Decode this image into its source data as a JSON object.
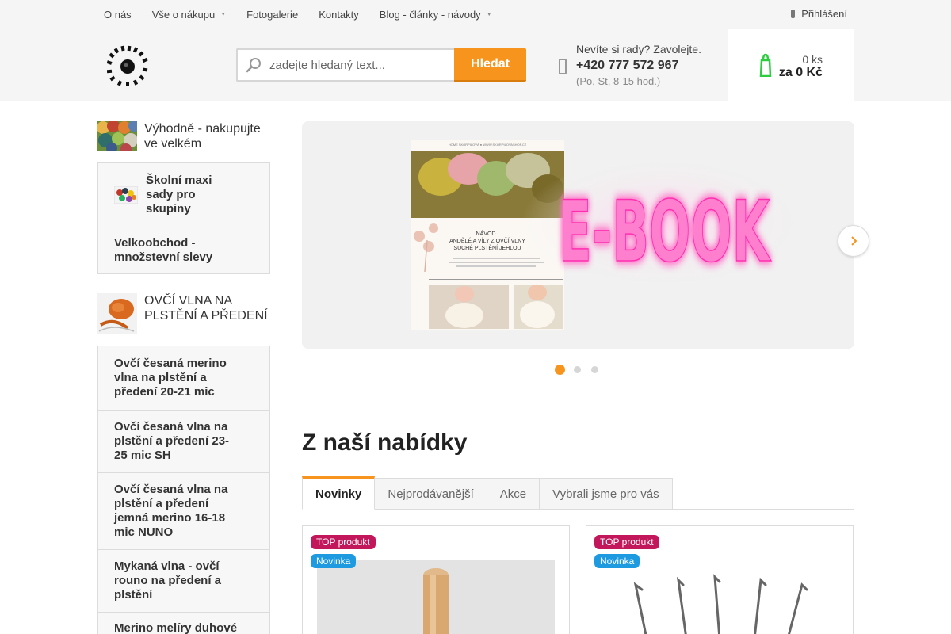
{
  "topnav": {
    "items": [
      {
        "label": "O nás",
        "has_dropdown": false
      },
      {
        "label": "Vše o nákupu",
        "has_dropdown": true
      },
      {
        "label": "Fotogalerie",
        "has_dropdown": false
      },
      {
        "label": "Kontakty",
        "has_dropdown": false
      },
      {
        "label": "Blog - články - návody",
        "has_dropdown": true
      }
    ],
    "login_label": "Přihlášení"
  },
  "header": {
    "search_placeholder": "zadejte hledaný text...",
    "search_button": "Hledat",
    "contact_question": "Nevíte si rady? Zavolejte.",
    "contact_phone": "+420 777 572 967",
    "contact_hours": "(Po, St, 8-15 hod.)",
    "cart_count": "0 ks",
    "cart_total": "za 0 Kč",
    "accent_color": "#f7941d",
    "cart_icon_color": "#2ecc40"
  },
  "sidebar": {
    "group1_title": "Výhodně - nakupujte ve velkém",
    "group1_items": [
      "Školní maxi sady pro skupiny",
      "Velkoobchod - množstevní slevy"
    ],
    "group2_title": "OVČÍ VLNA NA PLSTĚNÍ A PŘEDENÍ",
    "group2_items": [
      "Ovčí česaná merino vlna na plstění a předení 20-21 mic",
      "Ovčí česaná vlna na plstění a předení 23-25 mic SH",
      "Ovčí česaná vlna na plstění a předení jemná merino 16-18 mic NUNO",
      "Mykaná vlna - ovčí rouno na předení a plstění",
      "Merino melíry duhové"
    ]
  },
  "banner": {
    "ebook_text": "E-BOOK",
    "doc_header": "HOME ŠKORPILOVÁ      ●      WWW.SKORPILOVASHOP.CZ",
    "doc_guide_line1": "NÁVOD :",
    "doc_guide_line2": "ANDĚLÉ A VÍLY Z OVČÍ VLNY",
    "doc_guide_line3": "SUCHÉ PLSTĚNÍ JEHLOU",
    "slides_total": 3,
    "active_slide": 1
  },
  "offers": {
    "title": "Z naší nabídky",
    "tabs": [
      "Novinky",
      "Nejprodávanější",
      "Akce",
      "Vybrali jsme pro vás"
    ],
    "active_tab": 0,
    "products": [
      {
        "badges": [
          "TOP produkt",
          "Novinka"
        ],
        "image": "wooden-tool"
      },
      {
        "badges": [
          "TOP produkt",
          "Novinka"
        ],
        "image": "felting-needles"
      }
    ]
  }
}
